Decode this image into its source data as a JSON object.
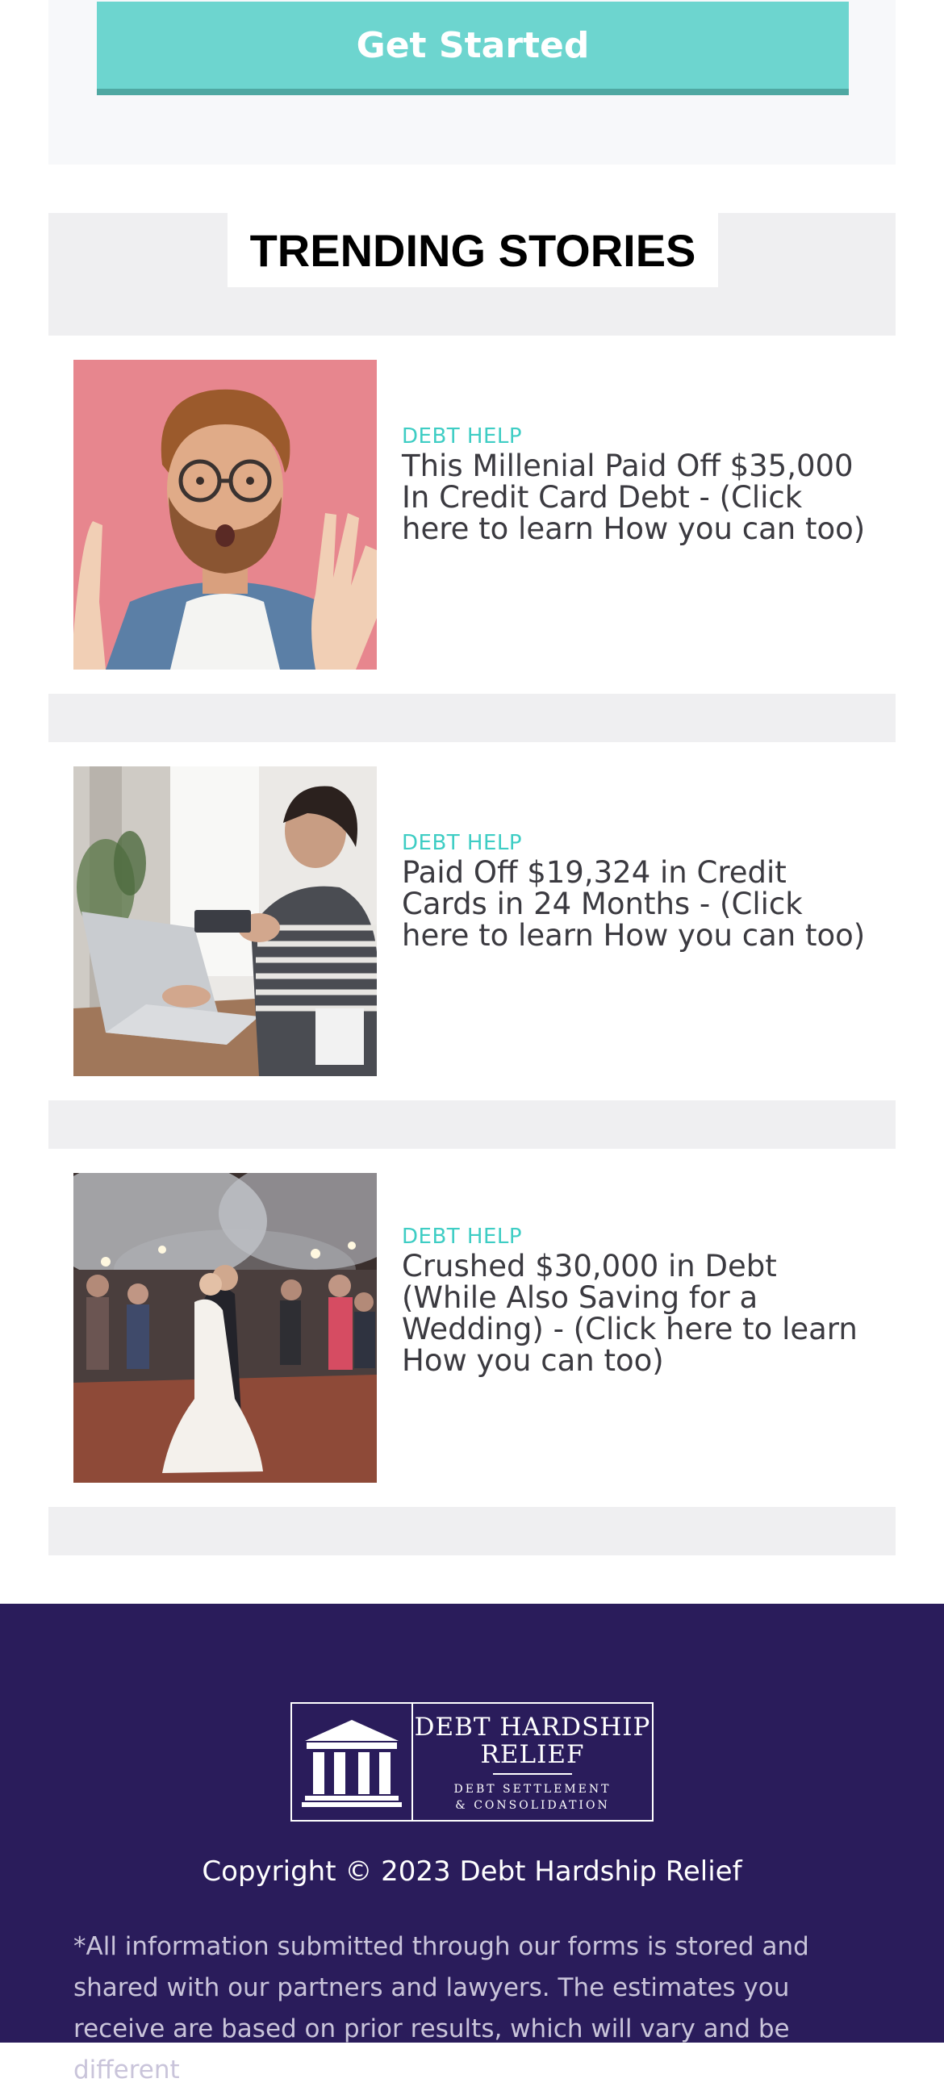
{
  "cta": {
    "label": "Get Started"
  },
  "trending": {
    "title": "TRENDING STORIES",
    "stories": [
      {
        "category": "DEBT HELP",
        "title": "This Millenial Paid Off $35,000 In Credit Card Debt - (Click here to learn How you can too)",
        "image": "surprised-man-photo"
      },
      {
        "category": "DEBT HELP",
        "title": "Paid Off $19,324 in Credit Cards in 24 Months - (Click here to learn How you can too)",
        "image": "woman-laptop-credit-card-photo"
      },
      {
        "category": "DEBT HELP",
        "title": "Crushed $30,000 in Debt (While Also Saving for a Wedding) - (Click here to learn How you can too)",
        "image": "wedding-couple-sparklers-photo"
      }
    ]
  },
  "footer": {
    "logo": {
      "name_line1": "DEBT HARDSHIP",
      "name_line2": "RELIEF",
      "tagline_line1": "DEBT SETTLEMENT",
      "tagline_line2": "& CONSOLIDATION",
      "icon": "columns-building-icon"
    },
    "copyright": "Copyright © 2023 Debt Hardship Relief",
    "disclaimer": "*All information submitted through our forms is stored and shared with our partners and lawyers. The estimates you receive are based on prior results, which will vary and be different"
  },
  "colors": {
    "accent": "#3ecdc4",
    "button": "#6dd5cf",
    "footer_bg": "#2a1c5b",
    "section_bg": "#efeff1"
  }
}
